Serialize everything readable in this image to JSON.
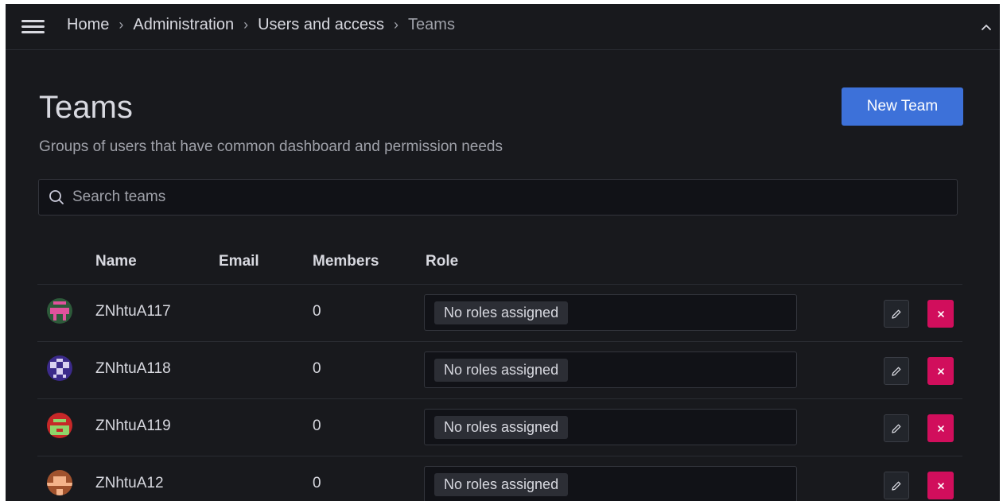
{
  "breadcrumb": {
    "items": [
      "Home",
      "Administration",
      "Users and access"
    ],
    "current": "Teams",
    "separator": "›"
  },
  "header": {
    "title": "Teams",
    "subtitle": "Groups of users that have common dashboard and permission needs",
    "new_button": "New Team"
  },
  "search": {
    "placeholder": "Search teams",
    "value": ""
  },
  "table": {
    "headers": {
      "name": "Name",
      "email": "Email",
      "members": "Members",
      "role": "Role"
    },
    "rows": [
      {
        "name": "ZNhtuA117",
        "email": "",
        "members": "0",
        "role": "No roles assigned",
        "avatar_color": "#e0529c",
        "avatar_bg": "#2d5a3a"
      },
      {
        "name": "ZNhtuA118",
        "email": "",
        "members": "0",
        "role": "No roles assigned",
        "avatar_color": "#d8d0f0",
        "avatar_bg": "#3b2a8a"
      },
      {
        "name": "ZNhtuA119",
        "email": "",
        "members": "0",
        "role": "No roles assigned",
        "avatar_color": "#8fd46a",
        "avatar_bg": "#c62828"
      },
      {
        "name": "ZNhtuA12",
        "email": "",
        "members": "0",
        "role": "No roles assigned",
        "avatar_color": "#f4b38a",
        "avatar_bg": "#a0522d"
      }
    ]
  },
  "icons": {
    "menu": "hamburger-icon",
    "collapse": "chevron-up-icon",
    "search": "search-icon",
    "edit": "pencil-icon",
    "delete": "close-icon"
  },
  "colors": {
    "primary": "#3d71d9",
    "danger": "#d10e5c",
    "background": "#18191d"
  }
}
